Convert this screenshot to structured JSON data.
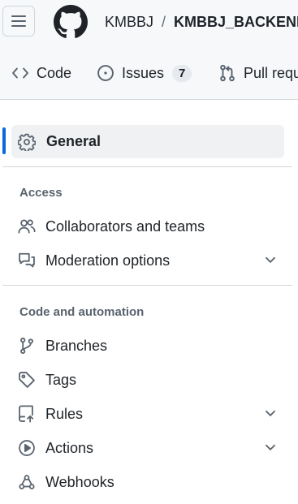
{
  "header": {
    "owner": "KMBBJ",
    "separator": "/",
    "repo": "KMBBJ_BACKEND"
  },
  "tabs": [
    {
      "label": "Code",
      "icon": "code-icon"
    },
    {
      "label": "Issues",
      "icon": "issue-opened-icon",
      "count": "7"
    },
    {
      "label": "Pull requ",
      "icon": "git-pull-request-icon"
    }
  ],
  "sidebar": {
    "general": {
      "label": "General",
      "icon": "gear-icon"
    },
    "access": {
      "title": "Access",
      "items": [
        {
          "label": "Collaborators and teams",
          "icon": "people-icon"
        },
        {
          "label": "Moderation options",
          "icon": "comment-discussion-icon",
          "expandable": true
        }
      ]
    },
    "code_automation": {
      "title": "Code and automation",
      "items": [
        {
          "label": "Branches",
          "icon": "git-branch-icon"
        },
        {
          "label": "Tags",
          "icon": "tag-icon"
        },
        {
          "label": "Rules",
          "icon": "repo-push-icon",
          "expandable": true
        },
        {
          "label": "Actions",
          "icon": "play-icon",
          "expandable": true
        },
        {
          "label": "Webhooks",
          "icon": "webhook-icon"
        }
      ]
    }
  },
  "colors": {
    "accent": "#0969da",
    "text": "#1f2328",
    "muted": "#59636e",
    "border": "#d0d7de",
    "header_bg": "#f6f8fa",
    "selected_bg": "#eff1f3"
  }
}
